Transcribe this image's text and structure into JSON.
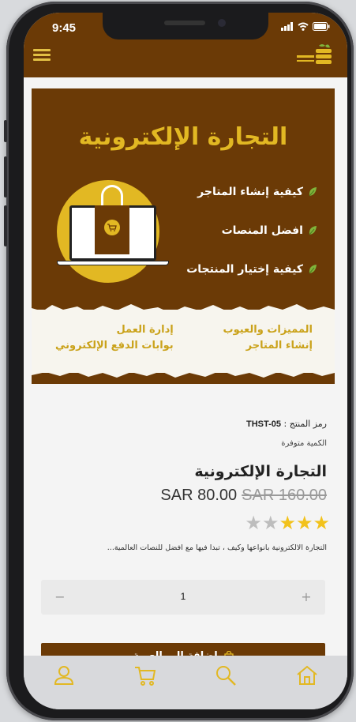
{
  "status_bar": {
    "time": "9:45"
  },
  "header": {
    "menu_icon": "hamburger-menu-icon",
    "logo_icon": "brand-logo-icon"
  },
  "banner": {
    "title": "التجارة الإلكترونية",
    "bullets": [
      "كيفية إنشاء المتاجر",
      "افضل المنصات",
      "كيفية إختيار المنتجات"
    ],
    "paper_right": [
      "المميزات والعيوب",
      "إنشاء المتاجر"
    ],
    "paper_left": [
      "إدارة العمل",
      "بوابات الدفع الإلكتروني"
    ]
  },
  "product": {
    "sku_label": "رمز المنتج :",
    "sku_value": "THST-05",
    "stock": "الكمية متوفرة",
    "title": "التجارة الإلكترونية",
    "price_current": "SAR 80.00",
    "price_old": "SAR 160.00",
    "rating": 3,
    "rating_max": 5,
    "description": "التجارة الالكترونية بانواعها وكيف ، تبدا فيها مع افضل للنصات العالمية..."
  },
  "quantity": {
    "minus": "−",
    "value": "1",
    "plus": "+"
  },
  "add_to_cart": {
    "label": "اضافة الى العربة"
  },
  "bottom_nav": [
    {
      "name": "profile",
      "icon": "user-icon"
    },
    {
      "name": "cart",
      "icon": "cart-icon"
    },
    {
      "name": "search",
      "icon": "search-icon"
    },
    {
      "name": "home",
      "icon": "home-icon"
    }
  ],
  "colors": {
    "brand_brown": "#6b3a06",
    "brand_gold": "#e2b823",
    "star_filled": "#f2c21b",
    "star_empty": "#bdbdbd"
  }
}
